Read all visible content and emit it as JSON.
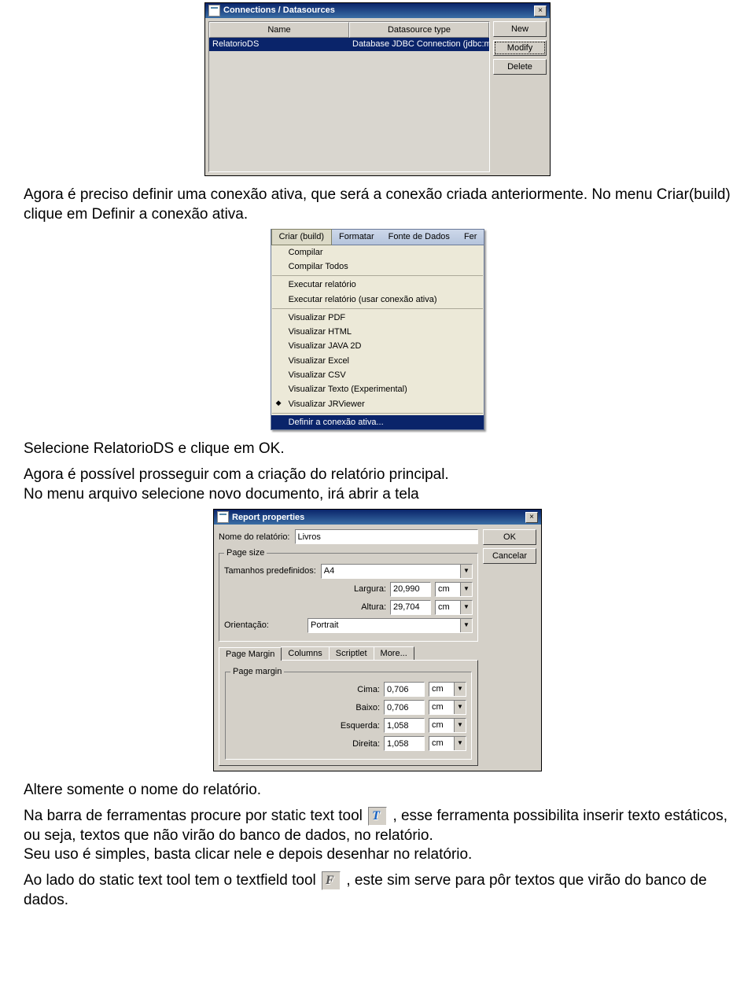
{
  "paragraphs": {
    "p1": "Agora é preciso definir uma conexão ativa, que será a conexão criada anteriormente. No menu Criar(build) clique em Definir a conexão ativa.",
    "p2": "Selecione RelatorioDS e clique em OK.",
    "p3": "Agora é possível prosseguir com a criação do relatório principal.",
    "p4": "No menu arquivo selecione novo documento, irá abrir a tela",
    "p5": "Altere somente o nome do relatório.",
    "p6a": "Na barra de ferramentas procure por  static text tool ",
    "p6b": ", esse ferramenta possibilita inserir texto estáticos, ou seja, textos que não virão do banco de dados, no relatório.",
    "p7": "Seu uso é simples, basta clicar nele e depois desenhar no relatório.",
    "p8a": "Ao lado do static text tool tem o textfield tool ",
    "p8b": ", este sim serve para pôr textos que virão do banco de dados."
  },
  "conn_dialog": {
    "title": "Connections / Datasources",
    "col_name": "Name",
    "col_type": "Datasource type",
    "row_name": "RelatorioDS",
    "row_type": "Database JDBC Connection (jdbc:my...",
    "btn_new": "New",
    "btn_modify": "Modify",
    "btn_delete": "Delete"
  },
  "menu": {
    "top": [
      "Criar (build)",
      "Formatar",
      "Fonte de Dados",
      "Fer"
    ],
    "items": [
      "Compilar",
      "Compilar Todos",
      "Executar relatório",
      "Executar relatório (usar conexão ativa)",
      "Visualizar PDF",
      "Visualizar HTML",
      "Visualizar JAVA 2D",
      "Visualizar Excel",
      "Visualizar CSV",
      "Visualizar Texto (Experimental)",
      "Visualizar JRViewer",
      "Definir a conexão ativa..."
    ]
  },
  "props": {
    "title": "Report properties",
    "lbl_nome": "Nome do relatório:",
    "val_nome": "Livros",
    "grp_page": "Page size",
    "lbl_tam": "Tamanhos predefinidos:",
    "val_tam": "A4",
    "lbl_larg": "Largura:",
    "val_larg": "20,990",
    "lbl_alt": "Altura:",
    "val_alt": "29,704",
    "unit_cm": "cm",
    "lbl_orient": "Orientação:",
    "val_orient": "Portrait",
    "tabs": [
      "Page Margin",
      "Columns",
      "Scriptlet",
      "More..."
    ],
    "grp_margin": "Page margin",
    "lbl_cima": "Cima:",
    "val_cima": "0,706",
    "lbl_baixo": "Baixo:",
    "val_baixo": "0,706",
    "lbl_esq": "Esquerda:",
    "val_esq": "1,058",
    "lbl_dir": "Direita:",
    "val_dir": "1,058",
    "btn_ok": "OK",
    "btn_cancel": "Cancelar"
  },
  "icons": {
    "t": "T",
    "f": "F"
  }
}
